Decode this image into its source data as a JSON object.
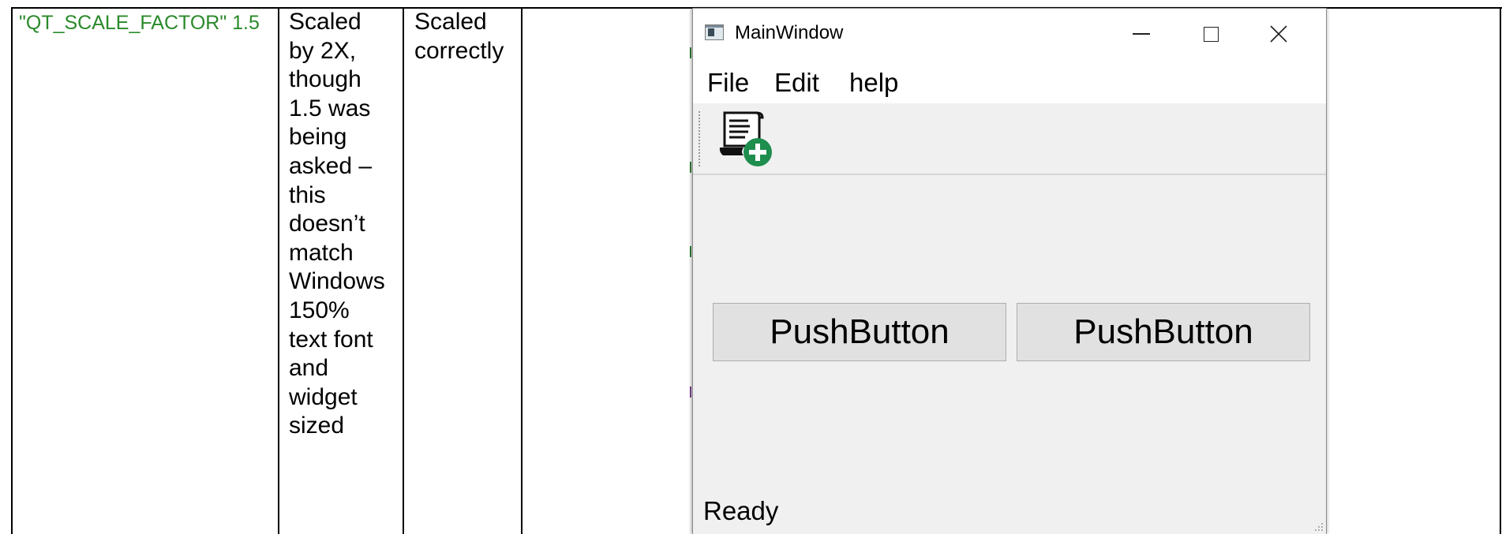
{
  "table": {
    "env_setting": "\"QT_SCALE_FACTOR\" 1.5",
    "col2_lines": [
      "Scaled",
      "by 2X,",
      "though",
      "1.5 was",
      "being",
      "asked –",
      "this",
      "doesn’t",
      "match",
      "Windows",
      "150%",
      "text font",
      "and",
      "widget",
      "sized"
    ],
    "col3_lines": [
      "Scaled",
      "correctly"
    ]
  },
  "window": {
    "title": "MainWindow",
    "menu": [
      "File",
      "Edit",
      "help"
    ],
    "toolbar_icon": "document-add-icon",
    "buttons": [
      "PushButton",
      "PushButton"
    ],
    "status": "Ready"
  },
  "colors": {
    "env_text": "#2a8a2a",
    "add_badge": "#1e8e4e",
    "button_face": "#e1e1e1",
    "window_bg": "#f0f0f0"
  }
}
